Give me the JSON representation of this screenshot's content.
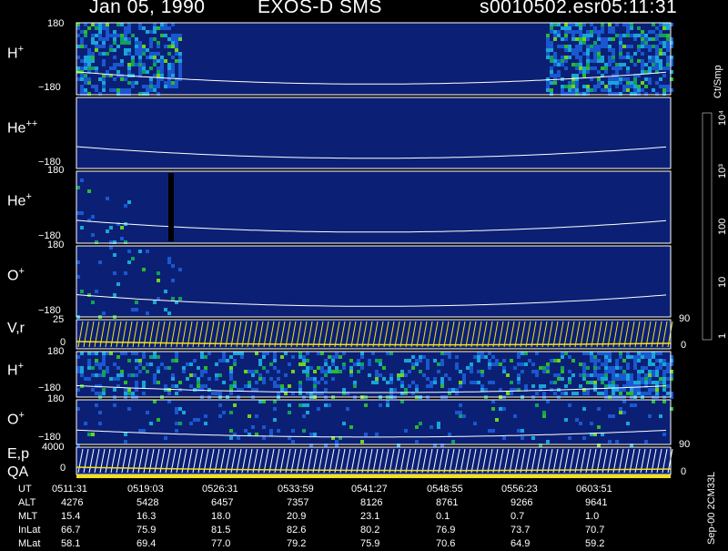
{
  "header": {
    "date": "Jan 05, 1990",
    "instrument": "EXOS-D SMS",
    "file": "s0010502.esr",
    "time": "05:11:31"
  },
  "panels": [
    {
      "id": "h-plus-1",
      "species": "H",
      "charge": "+",
      "ymax": "180",
      "ymin": "−180"
    },
    {
      "id": "he-plusplus",
      "species": "He",
      "charge": "++",
      "ymax": "",
      "ymin": "−180"
    },
    {
      "id": "he-plus",
      "species": "He",
      "charge": "+",
      "ymax": "180",
      "ymin": "−180"
    },
    {
      "id": "o-plus-1",
      "species": "O",
      "charge": "+",
      "ymax": "180",
      "ymin": "−180"
    },
    {
      "id": "vr",
      "species": "V,r",
      "charge": "",
      "ymax": "25",
      "ymin": "0",
      "right_top": "90",
      "right_bot": "0"
    },
    {
      "id": "h-plus-2",
      "species": "H",
      "charge": "+",
      "ymax": "180",
      "ymin": "−180"
    },
    {
      "id": "o-plus-2",
      "species": "O",
      "charge": "+",
      "ymax": "180",
      "ymin": "−180"
    },
    {
      "id": "ep",
      "species": "E,p",
      "charge": "",
      "ymax": "4000",
      "ymin": "0",
      "right_top": "90",
      "right_bot": "0"
    }
  ],
  "qa_label": "QA",
  "colorbar": {
    "unit": "Ct/Smp",
    "ticks": [
      "1",
      "10",
      "100",
      "10³",
      "10⁴"
    ],
    "colors": [
      "#1a1a6e",
      "#0b2a9a",
      "#1a57d0",
      "#19a5d8",
      "#24c7c7",
      "#12a05a",
      "#2db82d",
      "#6fd21c",
      "#c8e61a",
      "#f2e813",
      "#b8a826",
      "#7b6b14",
      "#c23b12",
      "#e01010",
      "#ff1a1a",
      "#ffffff"
    ]
  },
  "ut_table": {
    "rows": [
      {
        "label": "UT",
        "values": [
          "0511:31",
          "0519:03",
          "0526:31",
          "0533:59",
          "0541:27",
          "0548:55",
          "0556:23",
          "0603:51"
        ]
      },
      {
        "label": "ALT",
        "values": [
          "4276",
          "5428",
          "6457",
          "7357",
          "8126",
          "8761",
          "9266",
          "9641"
        ]
      },
      {
        "label": "MLT",
        "values": [
          "15.4",
          "16.3",
          "18.0",
          "20.9",
          "23.1",
          "0.1",
          "0.7",
          "1.0"
        ]
      },
      {
        "label": "InLat",
        "values": [
          "66.7",
          "75.9",
          "81.5",
          "82.6",
          "80.2",
          "76.9",
          "73.7",
          "70.7"
        ]
      },
      {
        "label": "MLat",
        "values": [
          "58.1",
          "69.4",
          "77.0",
          "79.2",
          "75.9",
          "70.6",
          "64.9",
          "59.2"
        ]
      }
    ]
  },
  "footer": "Sep-00 2CM33L",
  "chart_data": {
    "type": "heatmap",
    "title": "Jan 05, 1990   EXOS-D SMS",
    "x_ticks": [
      "0511:31",
      "0519:03",
      "0526:31",
      "0533:59",
      "0541:27",
      "0548:55",
      "0556:23",
      "0603:51"
    ],
    "series": [
      {
        "name": "H+",
        "ylim": [
          -180,
          180
        ]
      },
      {
        "name": "He++",
        "ylim": [
          -180,
          180
        ]
      },
      {
        "name": "He+",
        "ylim": [
          -180,
          180
        ]
      },
      {
        "name": "O+",
        "ylim": [
          -180,
          180
        ]
      },
      {
        "name": "V,r",
        "ylim": [
          0,
          25
        ]
      },
      {
        "name": "H+",
        "ylim": [
          -180,
          180
        ]
      },
      {
        "name": "O+",
        "ylim": [
          -180,
          180
        ]
      },
      {
        "name": "E,p",
        "ylim": [
          0,
          4000
        ]
      }
    ],
    "colorscale": {
      "unit": "Ct/Smp",
      "ticks": [
        "1",
        "10",
        "100",
        "10³",
        "10⁴"
      ],
      "scale": "log"
    }
  }
}
